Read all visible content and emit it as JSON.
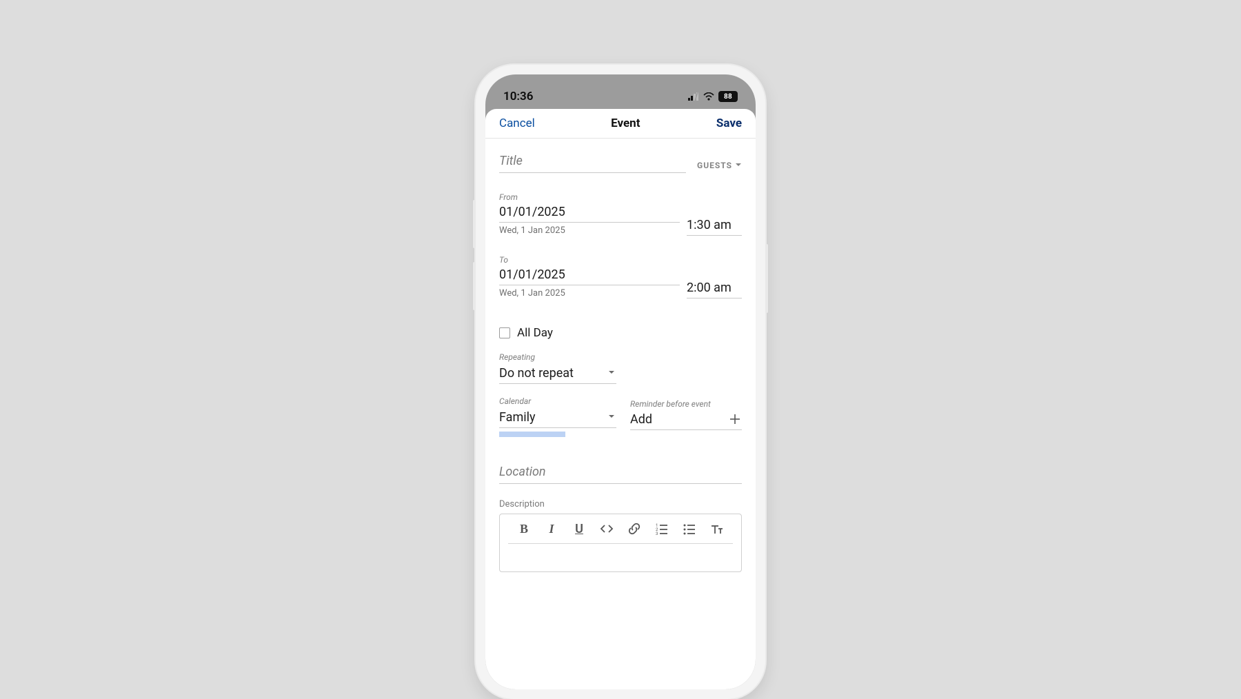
{
  "statusbar": {
    "time": "10:36",
    "battery": "88"
  },
  "header": {
    "cancel": "Cancel",
    "title": "Event",
    "save": "Save"
  },
  "form": {
    "title_placeholder": "Title",
    "guests_label": "GUESTS",
    "from_label": "From",
    "from_date": "01/01/2025",
    "from_day": "Wed, 1 Jan 2025",
    "from_time": "1:30 am",
    "to_label": "To",
    "to_date": "01/01/2025",
    "to_day": "Wed, 1 Jan 2025",
    "to_time": "2:00 am",
    "allday_label": "All Day",
    "allday_checked": false,
    "repeating_label": "Repeating",
    "repeating_value": "Do not repeat",
    "calendar_label": "Calendar",
    "calendar_value": "Family",
    "calendar_color": "#bcd2f4",
    "reminder_label": "Reminder before event",
    "reminder_value": "Add",
    "location_placeholder": "Location",
    "description_label": "Description"
  }
}
